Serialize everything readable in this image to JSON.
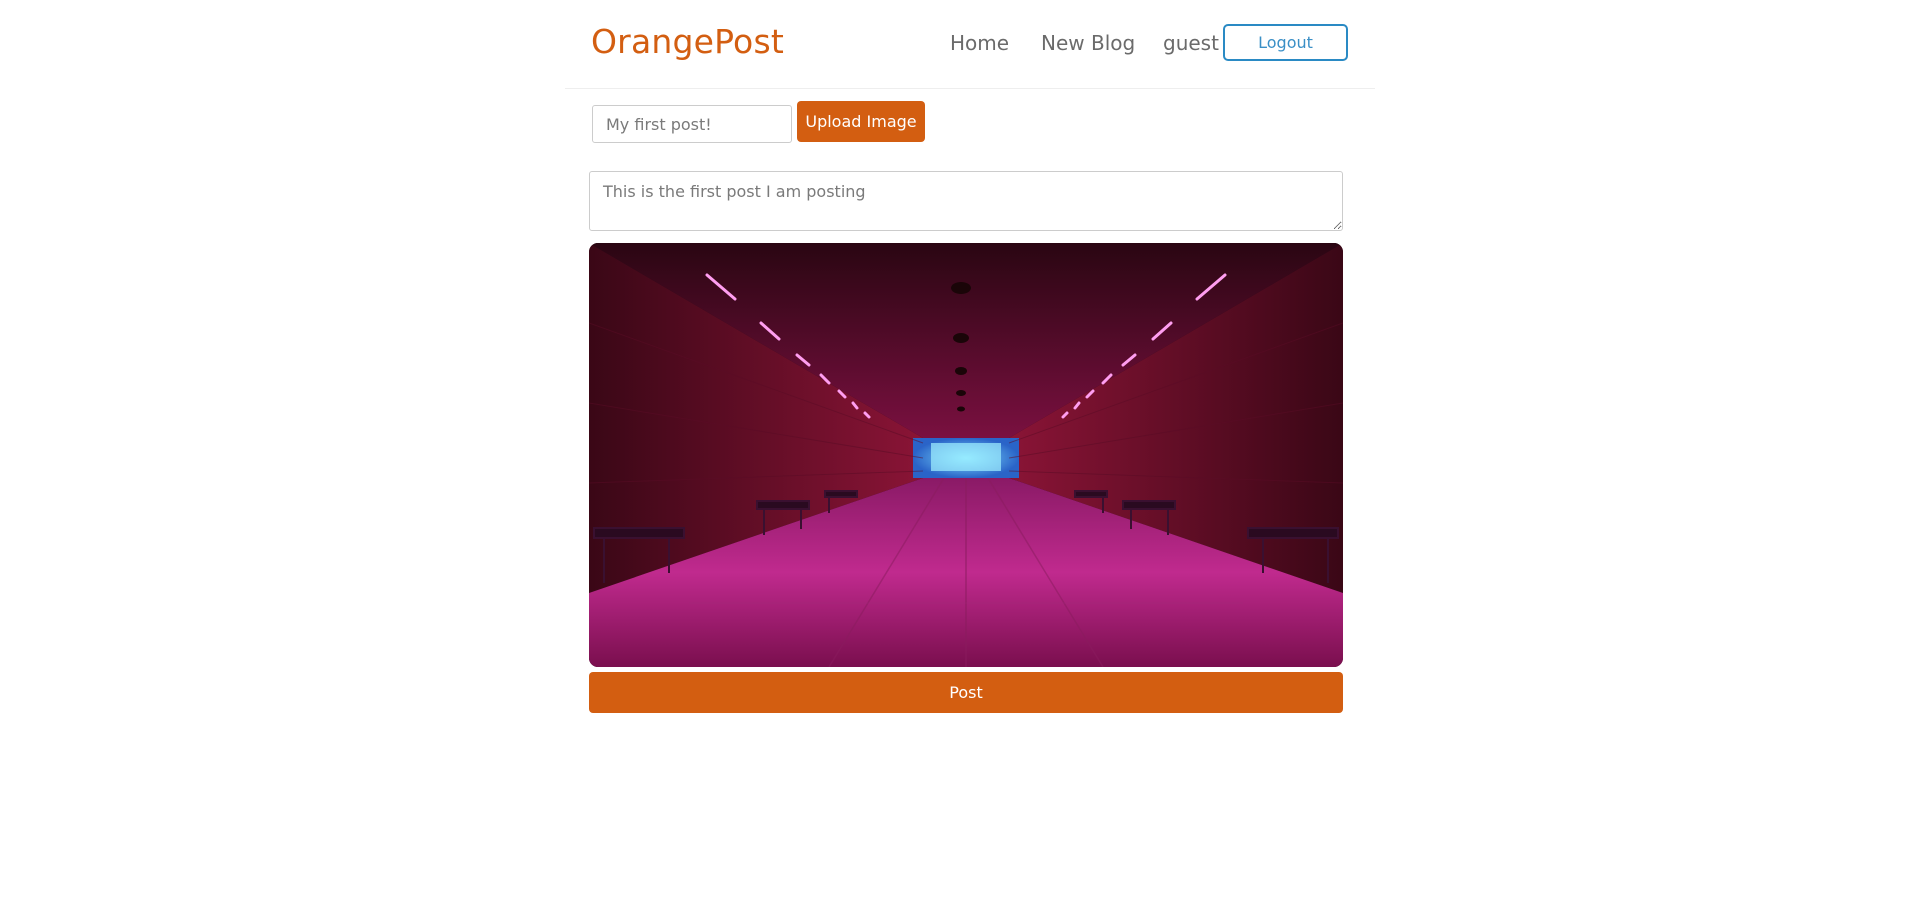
{
  "navbar": {
    "brand": "OrangePost",
    "links": [
      {
        "label": "Home"
      },
      {
        "label": "New Blog"
      }
    ],
    "username": "guest",
    "logout_label": "Logout"
  },
  "form": {
    "title_placeholder": "My first post!",
    "title_value": "",
    "upload_label": "Upload Image",
    "body_placeholder": "This is the first post I am posting",
    "body_value": "",
    "submit_label": "Post"
  },
  "preview": {
    "description": "uploaded image preview"
  },
  "colors": {
    "brand": "#d35e11",
    "logout_border": "#2a8ac4",
    "text_muted": "#6b6b6b"
  }
}
